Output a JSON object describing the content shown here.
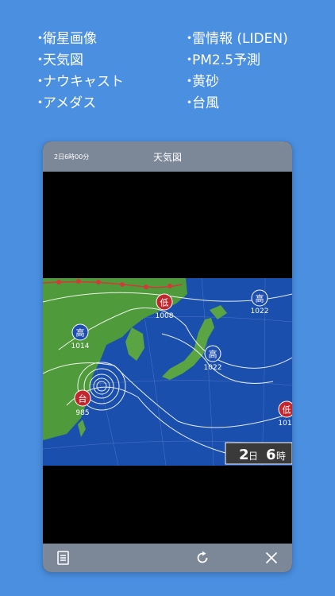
{
  "features": [
    {
      "bullet": "・",
      "label": "衛星画像"
    },
    {
      "bullet": "・",
      "label": "雷情報 (LIDEN)"
    },
    {
      "bullet": "・",
      "label": "天気図"
    },
    {
      "bullet": "・",
      "label": "PM2.5予測"
    },
    {
      "bullet": "・",
      "label": "ナウキャスト"
    },
    {
      "bullet": "・",
      "label": "黄砂"
    },
    {
      "bullet": "・",
      "label": "アメダス"
    },
    {
      "bullet": "・",
      "label": "台風"
    }
  ],
  "header": {
    "time_label": "2日6時00分",
    "title": "天気図"
  },
  "map": {
    "pressure_systems": [
      {
        "symbol": "低",
        "value": "1008"
      },
      {
        "symbol": "高",
        "value": "1022"
      },
      {
        "symbol": "高",
        "value": "1014"
      },
      {
        "symbol": "高",
        "value": "1022"
      },
      {
        "symbol": "台",
        "value": "985"
      },
      {
        "symbol": "低",
        "value": "101"
      }
    ],
    "date_overlay": {
      "day": "2",
      "day_unit": "日",
      "hour": "6",
      "hour_unit": "時"
    },
    "colors": {
      "sea": "#1a4fae",
      "land": "#4f9a3a",
      "low": "#c2272d",
      "high": "#1f4fb0"
    }
  },
  "toolbar": {
    "icons": [
      "list-icon",
      "refresh-icon",
      "close-icon"
    ]
  }
}
